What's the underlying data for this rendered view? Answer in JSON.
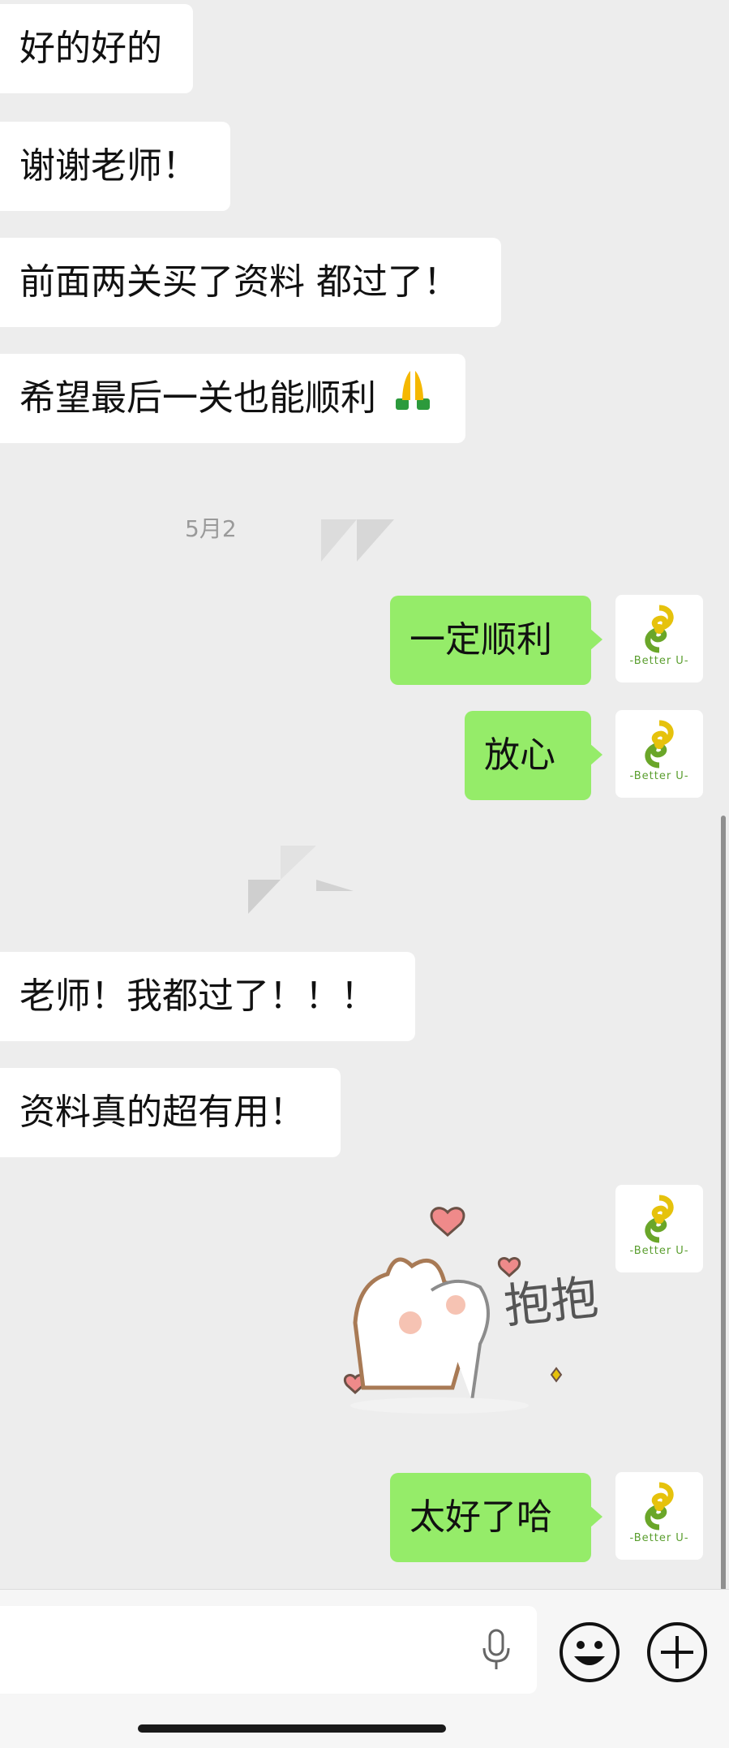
{
  "messages": [
    {
      "side": "left",
      "text": "好的好的"
    },
    {
      "side": "left",
      "text": "谢谢老师！"
    },
    {
      "side": "left",
      "text": "前面两关买了资料 都过了！"
    },
    {
      "side": "left",
      "text": "希望最后一关也能顺利"
    },
    {
      "side": "timestamp",
      "text": "5月2"
    },
    {
      "side": "right",
      "text": "一定顺利"
    },
    {
      "side": "right",
      "text": "放心"
    },
    {
      "side": "left",
      "text": "老师！我都过了！！！"
    },
    {
      "side": "left",
      "text": "资料真的超有用！"
    },
    {
      "side": "right",
      "sticker": "抱抱"
    },
    {
      "side": "right",
      "text": "太好了哈"
    }
  ],
  "emoji_after_msg4": "pray-emoji",
  "avatar_caption": "-Better U-",
  "colors": {
    "background": "#ededed",
    "left_bubble": "#ffffff",
    "right_bubble": "#95ec69",
    "logo_yellow": "#e6c20c",
    "logo_green": "#6aa629"
  },
  "bottom_bar": {
    "icons": [
      "mic-icon",
      "emoji-icon",
      "plus-icon"
    ]
  }
}
